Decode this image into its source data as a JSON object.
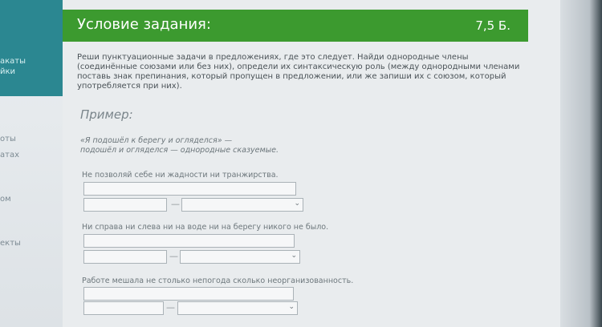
{
  "sidebar": {
    "items": [
      {
        "label": "акаты"
      },
      {
        "label": "йки"
      },
      {
        "label": "оты"
      },
      {
        "label": "атах"
      },
      {
        "label": "ом"
      },
      {
        "label": "екты"
      }
    ]
  },
  "header": {
    "title": "Условие задания:",
    "points": "7,5 Б."
  },
  "instructions": "Реши пунктуационные задачи в предложениях, где это следует. Найди однородные члены (соединённые союзами или без них), определи их синтаксическую роль (между однородными членами поставь знак препинания, который пропущен в предложении, или же запиши их с союзом, который употребляется при них).",
  "example": {
    "title": "Пример:",
    "line1": "«Я подошёл к берегу и огляделся» —",
    "line2": "подошёл и огляделся — однородные сказуемые."
  },
  "tasks": [
    {
      "sentence": "Не позволяй себе ни жадности ни транжирства.",
      "separator": "—",
      "answer1": "",
      "answer2": "",
      "select": ""
    },
    {
      "sentence": "Ни справа ни слева ни на воде ни на берегу никого не было.",
      "separator": "—",
      "answer1": "",
      "answer2": "",
      "select": ""
    },
    {
      "sentence": "Работе мешала не столько непогода сколько неорганизованность.",
      "separator": "—",
      "answer1": "",
      "answer2": "",
      "select": ""
    }
  ],
  "icons": {
    "select_arrow": "chevron-down-icon"
  },
  "colors": {
    "header": "#3c9a2f",
    "sidebar_teal": "#2b8791",
    "panel": "#e9ecee"
  }
}
